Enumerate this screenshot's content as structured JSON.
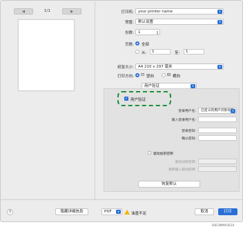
{
  "nav": {
    "prev": "◀",
    "next": "▶",
    "page_count": "1/1"
  },
  "printer": {
    "label": "打印机:",
    "value": "your printer name"
  },
  "preset": {
    "label": "预置:",
    "value": "默认设置"
  },
  "copies": {
    "label": "份数:",
    "value": "1"
  },
  "pages": {
    "label": "页数:",
    "all": "全部",
    "from": "从:",
    "from_value": "1",
    "to": "至:",
    "to_value": "1"
  },
  "paper_size": {
    "label": "纸张大小:",
    "value": "A4 210 x 297 毫米"
  },
  "orientation": {
    "label": "打印方向:",
    "portrait": "竖向",
    "landscape": "横向"
  },
  "section_menu": {
    "value": "用户验证"
  },
  "user_auth": {
    "checkbox_label": "用户验证",
    "checked": true
  },
  "login_name": {
    "label": "登录用户名:",
    "value": "已定义的用户识别号码"
  },
  "login_user": {
    "label": "输入登录用户名:"
  },
  "password": {
    "label": "登录密码:",
    "confirm_label": "确认密码:"
  },
  "encrypt": {
    "checkbox_label": "驱动加密密钥",
    "key_label": "驱动加密密钥:",
    "key_confirm_label": "重新输入驱动密钥:"
  },
  "restore_button": "恢复默认",
  "footer": {
    "help": "?",
    "hide_details": "隐藏详细信息",
    "pdf": "PDF",
    "low_toner": "油墨不足",
    "cancel": "取消",
    "print": "打印",
    "code": "D0CWMA5610"
  },
  "colors": {
    "accent": "#2a6fd6",
    "highlight": "#1f8f3a",
    "warning": "#f3b400"
  }
}
